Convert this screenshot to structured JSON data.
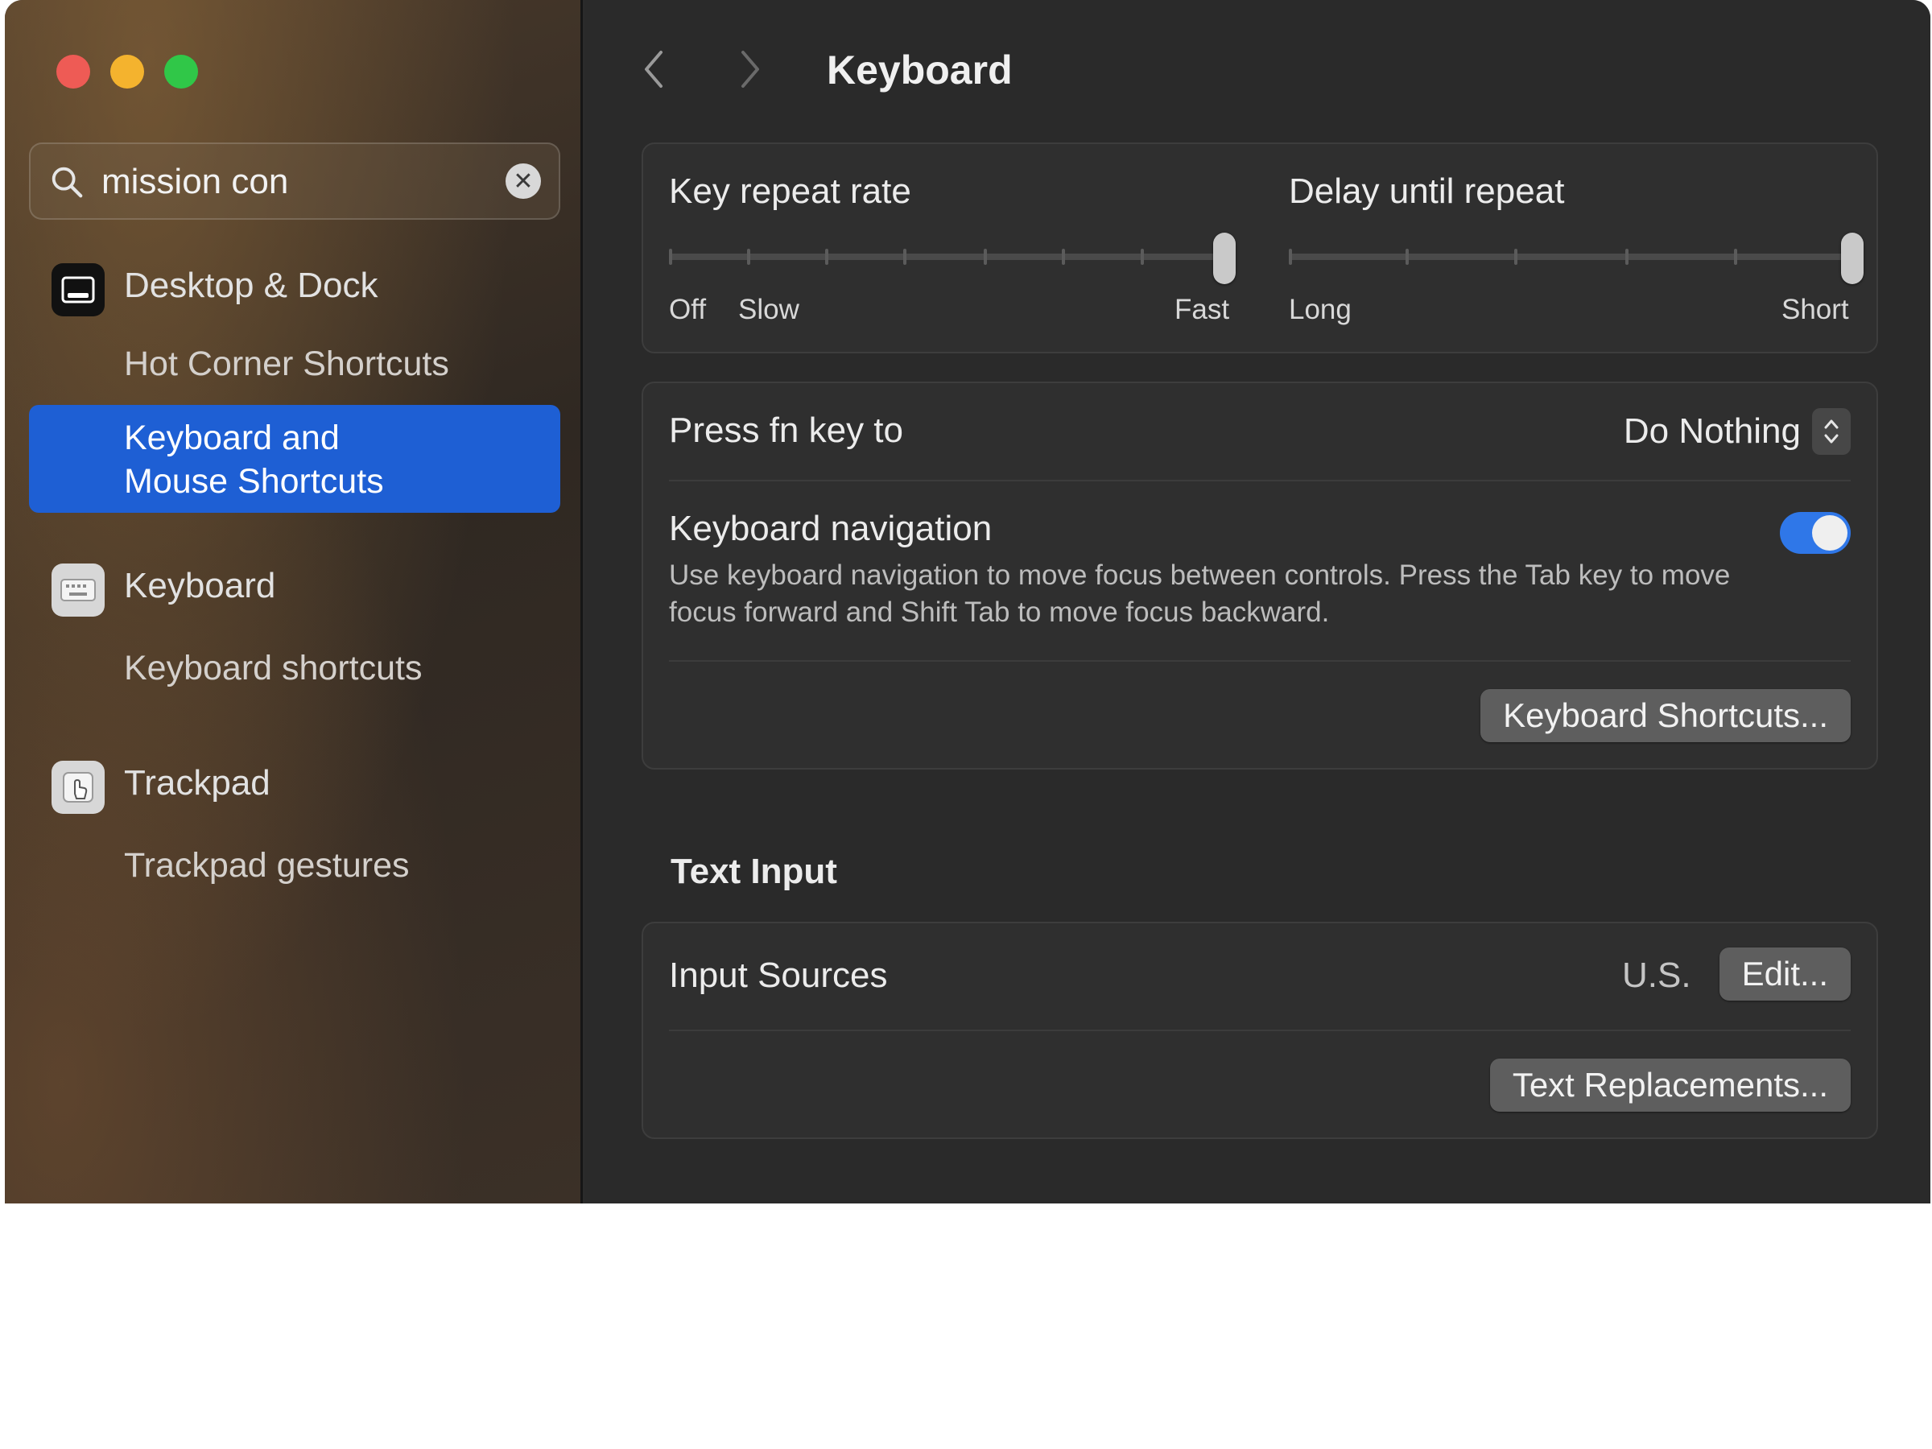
{
  "window": {
    "title": "Keyboard"
  },
  "search": {
    "value": "mission con",
    "placeholder": "Search"
  },
  "sidebar": {
    "desktop_dock": {
      "label": "Desktop & Dock",
      "icon": "desktop-dock-icon",
      "sub": "Hot Corner Shortcuts"
    },
    "selected": {
      "line1": "Keyboard and",
      "line2": "Mouse Shortcuts"
    },
    "keyboard": {
      "label": "Keyboard",
      "icon": "keyboard-icon",
      "sub": "Keyboard shortcuts"
    },
    "trackpad": {
      "label": "Trackpad",
      "icon": "trackpad-icon",
      "sub": "Trackpad gestures"
    }
  },
  "repeat": {
    "key_repeat_label": "Key repeat rate",
    "key_repeat_min": "Off",
    "key_repeat_slow": "Slow",
    "key_repeat_max": "Fast",
    "key_repeat_value": 1.0,
    "delay_label": "Delay until repeat",
    "delay_min": "Long",
    "delay_max": "Short",
    "delay_value": 1.0
  },
  "fn": {
    "label": "Press fn key to",
    "value": "Do Nothing"
  },
  "keyboard_nav": {
    "label": "Keyboard navigation",
    "description": "Use keyboard navigation to move focus between controls. Press the Tab key to move focus forward and Shift Tab to move focus backward.",
    "enabled": true
  },
  "buttons": {
    "keyboard_shortcuts": "Keyboard Shortcuts...",
    "edit": "Edit...",
    "text_replacements": "Text Replacements..."
  },
  "text_input": {
    "section_title": "Text Input",
    "input_sources_label": "Input Sources",
    "input_sources_value": "U.S."
  },
  "colors": {
    "accent": "#2f77e8",
    "selection": "#1e5fd4"
  }
}
